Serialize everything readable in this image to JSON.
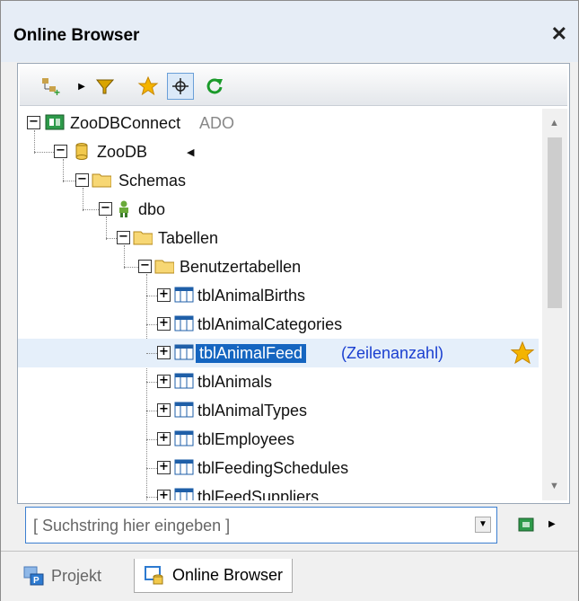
{
  "window": {
    "title": "Online Browser",
    "close": "✕"
  },
  "toolbar": {
    "buttons": [
      "add-connection",
      "filter",
      "favorites",
      "locate",
      "refresh"
    ]
  },
  "tree": {
    "connection": {
      "name": "ZooDBConnect",
      "type": "ADO"
    },
    "database": "ZooDB",
    "schemas": "Schemas",
    "schema": "dbo",
    "tables": "Tabellen",
    "user_tables": "Benutzertabellen",
    "items": [
      "tblAnimalBirths",
      "tblAnimalCategories",
      "tblAnimalFeed",
      "tblAnimals",
      "tblAnimalTypes",
      "tblEmployees",
      "tblFeedingSchedules",
      "tblFeedSuppliers"
    ],
    "selected_suffix": "(Zeilenanzahl)"
  },
  "search": {
    "placeholder": "[ Suchstring hier eingeben ]"
  },
  "tabs": {
    "project": "Projekt",
    "online_browser": "Online Browser"
  },
  "colors": {
    "selection": "#1565c0",
    "folder": "#f2c94c",
    "star": "#f4b400"
  }
}
